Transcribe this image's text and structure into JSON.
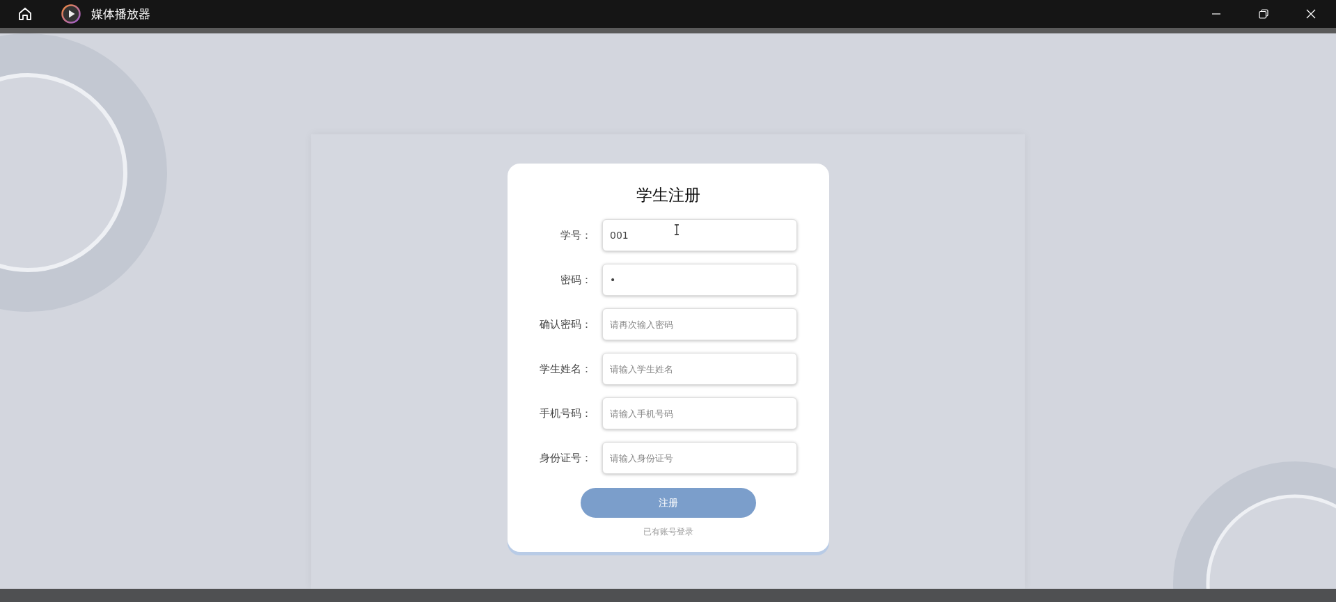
{
  "window": {
    "title": "媒体播放器"
  },
  "form": {
    "title": "学生注册",
    "fields": [
      {
        "label": "学号：",
        "value": "001"
      },
      {
        "label": "密码：",
        "value": "•"
      },
      {
        "label": "确认密码：",
        "placeholder": "请再次输入密码"
      },
      {
        "label": "学生姓名：",
        "placeholder": "请输入学生姓名"
      },
      {
        "label": "手机号码：",
        "placeholder": "请输入手机号码"
      },
      {
        "label": "身份证号：",
        "placeholder": "请输入身份证号"
      }
    ],
    "submit": "注册",
    "login_link": "已有账号登录"
  }
}
